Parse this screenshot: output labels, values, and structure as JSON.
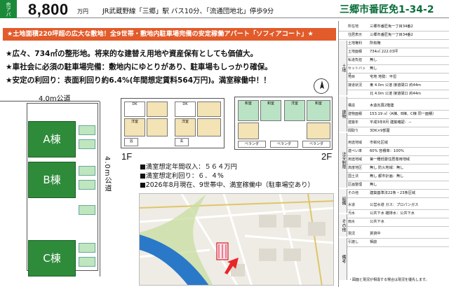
{
  "header": {
    "type_tag": "売アパート",
    "price": "8,800",
    "price_unit": "万円",
    "access": "JR武蔵野線「三郷」駅 バス10分、「流通団地北」停歩9分",
    "address": "三郷市番匠免1-34-2"
  },
  "banner": "★土地面積220坪超の広大な敷地！全9世帯・敷地内駐車場完備の安定稼働アパート「ソフィアコート」★",
  "bullets": [
    "★広々、734㎡の整形地。将来的な建替え用地や資産保有としても価値大。",
    "★車社会に必須の駐車場完備：敷地内にゆとりがあり、駐車場もしっかり確保。",
    "★安定の利回り：表面利回り約6.4%(年間想定賃料564万円)。満室稼働中！！"
  ],
  "site_plan": {
    "road_top": "4.0m公道",
    "road_right": "4.0m公道",
    "buildings": [
      "A棟",
      "B棟",
      "C棟"
    ]
  },
  "floor_plans": {
    "first": "1F",
    "second": "2F",
    "rooms_1f": [
      "DK",
      "洋室",
      "DK",
      "洋室",
      "浴",
      "玄"
    ],
    "rooms_2f": [
      "和室",
      "和室",
      "洋室",
      "和室",
      "ベランダ",
      "ベランダ",
      "ベランダ"
    ]
  },
  "info": [
    "■満室想定年間収入：５６４万円",
    "■満室想定利回り：６．４%",
    "■2026年8月現在、9世帯中、満室稼働中（駐車場空あり）"
  ],
  "table": {
    "rows": [
      {
        "label": "所在地",
        "value": "三郷市番匠免一丁目34番2"
      },
      {
        "label": "住居表示",
        "value": "三郷市番匠免一丁目34番2"
      },
      {
        "label": "土地権利",
        "value": "所有権"
      },
      {
        "label": "土地面積",
        "value": "734㎡  222.03坪"
      },
      {
        "label": "私道負担",
        "value": "無し"
      },
      {
        "label": "セットバック",
        "value": "無し"
      },
      {
        "label": "地目",
        "value": "宅地    地勢：平坦"
      },
      {
        "label": "接道状況",
        "value": "東 4.0m 公道  接道間口 約44m"
      },
      {
        "label": "",
        "value": "北 4.0m 公道  接道間口 約44m"
      },
      {
        "label": "構造",
        "value": "木造瓦葺2階建"
      },
      {
        "label": "建物面積",
        "value": "153.19 ㎡（A棟、B棟、C棟 同一面積）"
      },
      {
        "label": "建築年",
        "value": "平成3年8月    建築確認：－"
      },
      {
        "label": "間取り",
        "value": "3DK×9部屋"
      },
      {
        "label": "用途地域",
        "value": "市街化区域"
      },
      {
        "label": "建ぺい率",
        "value": "60%         容積率：100%"
      },
      {
        "label": "用途地域",
        "value": "第一種低層住居専用地域"
      },
      {
        "label": "高度地区",
        "value": "無し        防火地域：無し"
      },
      {
        "label": "国土法",
        "value": "無し        都市計画：無し"
      },
      {
        "label": "区画整理",
        "value": "無し"
      },
      {
        "label": "その他",
        "value": "建築基準法22条・23条区域"
      },
      {
        "label": "水道",
        "value": "公営水道    ガス：プロパンガス"
      },
      {
        "label": "汚水",
        "value": "公共下水    雑排水：公共下水"
      },
      {
        "label": "雨水",
        "value": "公共下水"
      },
      {
        "label": "現況",
        "value": "賃貸中"
      },
      {
        "label": "引渡し",
        "value": "相談"
      }
    ],
    "sections": [
      "土地",
      "建物",
      "法令制限",
      "設備",
      "その他",
      "備考"
    ],
    "footnote": "・図面と現況が相違する場合は現況を優先します。"
  },
  "colors": {
    "accent_green": "#0a6e3b",
    "banner_orange": "#e25b2a",
    "building_green": "#2e8b3a",
    "arrow_red": "#e8262a"
  }
}
